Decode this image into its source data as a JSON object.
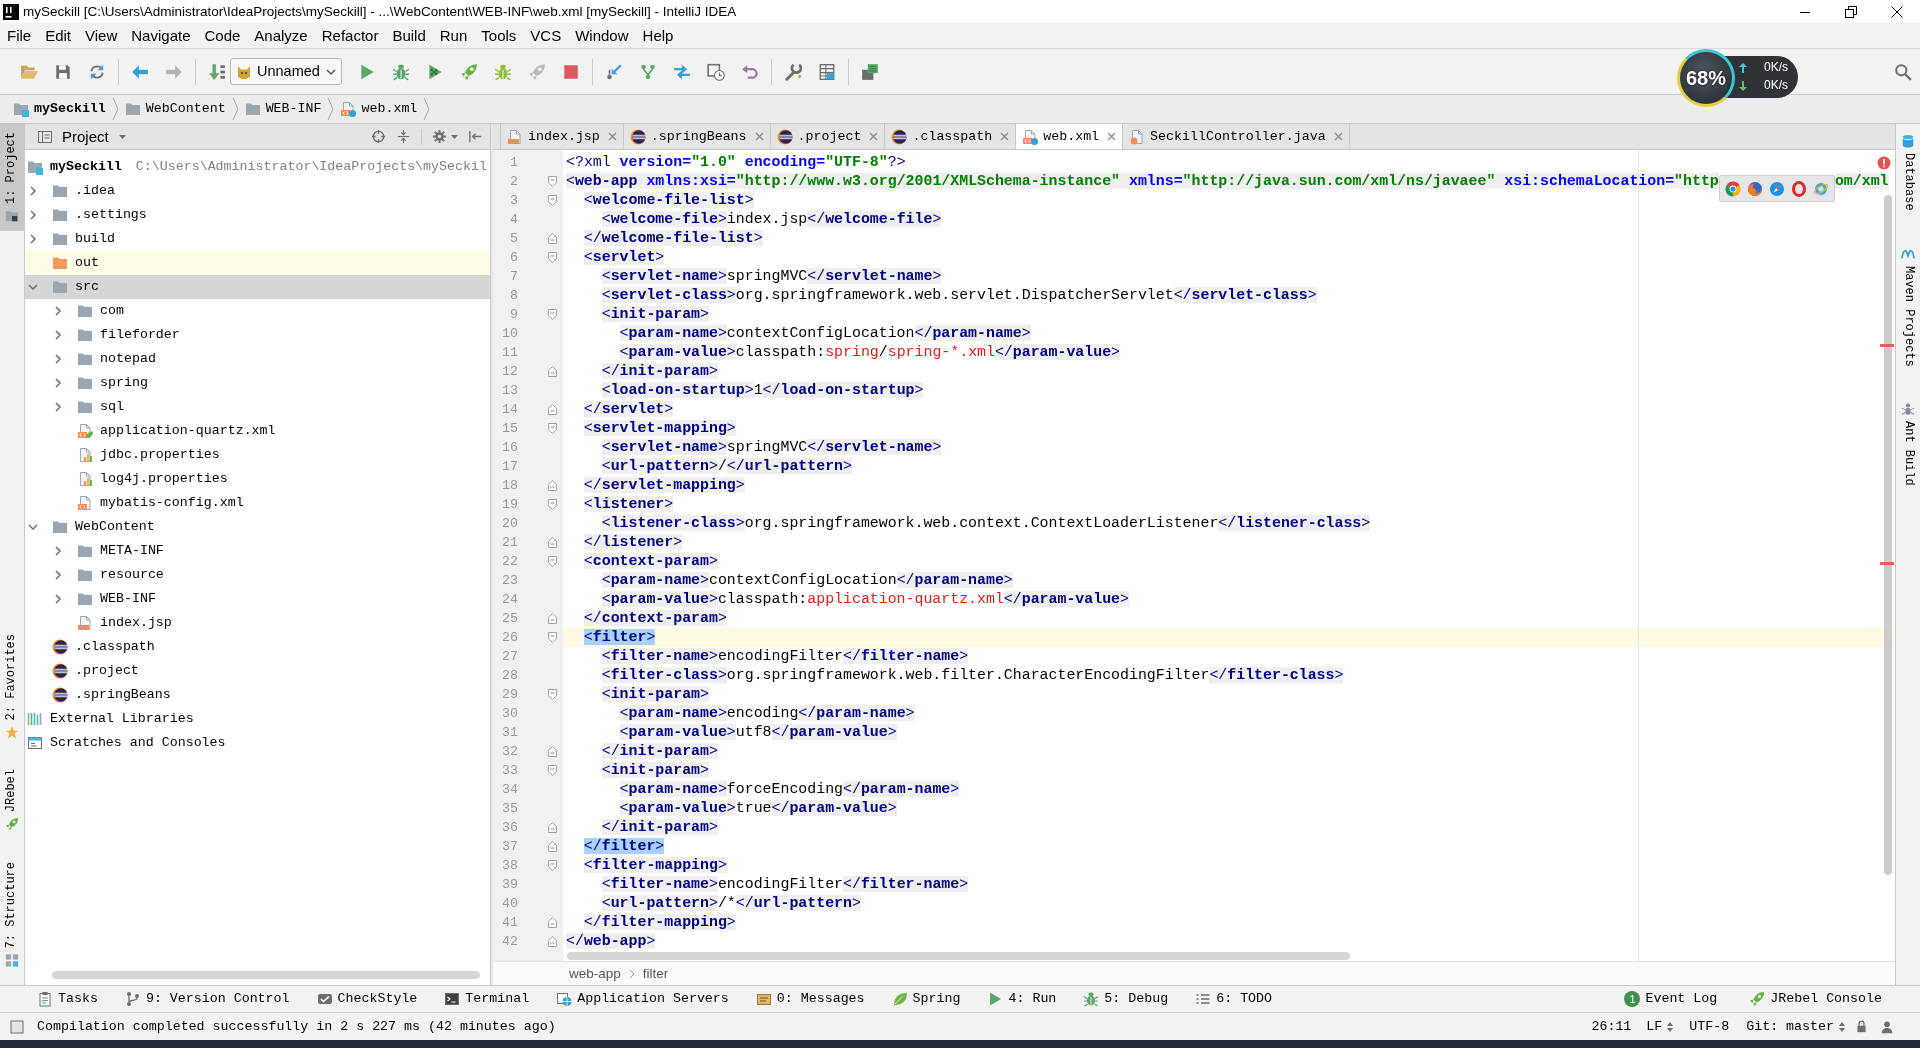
{
  "window": {
    "title": "mySeckill [C:\\Users\\Administrator\\IdeaProjects\\mySeckill] - ...\\WebContent\\WEB-INF\\web.xml [mySeckill] - IntelliJ IDEA"
  },
  "menu": [
    "File",
    "Edit",
    "View",
    "Navigate",
    "Code",
    "Analyze",
    "Refactor",
    "Build",
    "Run",
    "Tools",
    "VCS",
    "Window",
    "Help"
  ],
  "toolbar": {
    "run_configuration": "Unnamed"
  },
  "network_monitor": {
    "percent": "68%",
    "upload": "0K/s",
    "download": "0K/s"
  },
  "navigation_bar": [
    {
      "label": "mySeckill",
      "kind": "module"
    },
    {
      "label": "WebContent",
      "kind": "folder"
    },
    {
      "label": "WEB-INF",
      "kind": "folder"
    },
    {
      "label": "web.xml",
      "kind": "web_xml"
    }
  ],
  "left_tool_strip": {
    "top": [
      {
        "label": "1: Project",
        "kind": "project",
        "selected": true
      }
    ],
    "bottom": [
      {
        "label": "2: Favorites",
        "kind": "favorites",
        "selected": false
      },
      {
        "label": "JRebel",
        "kind": "jrebel",
        "selected": false
      },
      {
        "label": "7: Structure",
        "kind": "structure",
        "selected": false
      }
    ]
  },
  "project_panel": {
    "title": "Project",
    "tree": [
      {
        "label": "mySeckill",
        "path": "C:\\Users\\Administrator\\IdeaProjects\\mySeckil",
        "kind": "module",
        "selected": false,
        "highlighted": false,
        "children": [
          {
            "label": ".idea",
            "kind": "folder",
            "expanded": false,
            "selected": false,
            "highlighted": false
          },
          {
            "label": ".settings",
            "kind": "folder",
            "expanded": false,
            "selected": false,
            "highlighted": false
          },
          {
            "label": "build",
            "kind": "folder",
            "expanded": false,
            "selected": false,
            "highlighted": false
          },
          {
            "label": "out",
            "kind": "excluded_folder",
            "selected": false,
            "highlighted": true
          },
          {
            "label": "src",
            "kind": "folder",
            "expanded": true,
            "selected": true,
            "highlighted": false,
            "children": [
              {
                "label": "com",
                "kind": "folder",
                "expanded": false,
                "selected": false,
                "highlighted": false
              },
              {
                "label": "fileforder",
                "kind": "folder",
                "expanded": false,
                "selected": false,
                "highlighted": false
              },
              {
                "label": "notepad",
                "kind": "folder",
                "expanded": false,
                "selected": false,
                "highlighted": false
              },
              {
                "label": "spring",
                "kind": "folder",
                "expanded": false,
                "selected": false,
                "highlighted": false
              },
              {
                "label": "sql",
                "kind": "folder",
                "expanded": false,
                "selected": false,
                "highlighted": false
              },
              {
                "label": "application-quartz.xml",
                "kind": "spring_xml",
                "selected": false,
                "highlighted": false
              },
              {
                "label": "jdbc.properties",
                "kind": "properties",
                "selected": false,
                "highlighted": false
              },
              {
                "label": "log4j.properties",
                "kind": "properties",
                "selected": false,
                "highlighted": false
              },
              {
                "label": "mybatis-config.xml",
                "kind": "xml",
                "selected": false,
                "highlighted": false
              }
            ]
          },
          {
            "label": "WebContent",
            "kind": "folder",
            "expanded": true,
            "selected": false,
            "highlighted": false,
            "children": [
              {
                "label": "META-INF",
                "kind": "folder",
                "expanded": false,
                "selected": false,
                "highlighted": false
              },
              {
                "label": "resource",
                "kind": "folder",
                "expanded": false,
                "selected": false,
                "highlighted": false
              },
              {
                "label": "WEB-INF",
                "kind": "folder",
                "expanded": false,
                "selected": false,
                "highlighted": false
              },
              {
                "label": "index.jsp",
                "kind": "jsp",
                "selected": false,
                "highlighted": false
              }
            ]
          },
          {
            "label": ".classpath",
            "kind": "eclipse",
            "selected": false,
            "highlighted": false
          },
          {
            "label": ".project",
            "kind": "eclipse",
            "selected": false,
            "highlighted": false
          },
          {
            "label": ".springBeans",
            "kind": "eclipse",
            "selected": false,
            "highlighted": false
          }
        ]
      },
      {
        "label": "External Libraries",
        "kind": "libraries",
        "selected": false,
        "highlighted": false
      },
      {
        "label": "Scratches and Consoles",
        "kind": "scratches",
        "selected": false,
        "highlighted": false
      }
    ]
  },
  "editor": {
    "tabs": [
      {
        "label": "index.jsp",
        "kind": "jsp",
        "selected": false
      },
      {
        "label": ".springBeans",
        "kind": "eclipse",
        "selected": false
      },
      {
        "label": ".project",
        "kind": "eclipse",
        "selected": false
      },
      {
        "label": ".classpath",
        "kind": "eclipse",
        "selected": false
      },
      {
        "label": "web.xml",
        "kind": "web_xml",
        "selected": true
      },
      {
        "label": "SeckillController.java",
        "kind": "java",
        "selected": false
      }
    ],
    "lines": [
      {
        "n": "1",
        "current": false,
        "parts": [
          {
            "kind": "pi",
            "o": "<?",
            "t": "xml",
            "attrs": [
              {
                "a": " version=",
                "v": "\"1.0\""
              },
              {
                "a": " encoding=",
                "v": "\"UTF-8\""
              }
            ],
            "c": "?>"
          }
        ]
      },
      {
        "n": "2",
        "kind": "fold_start",
        "current": false,
        "parts": [
          {
            "kind": "tag",
            "o": "<",
            "t": "web-app",
            "attrs": [
              {
                "a": " xmlns:xsi=",
                "v": "\"http://www.w3.org/2001/XMLSchema-instance\""
              },
              {
                "a": " xmlns=",
                "v": "\"http://java.sun.com/xml/ns/javaee\""
              },
              {
                "a": " xsi:schemaLocation=",
                "v": "\"http"
              }
            ]
          },
          {
            "kind": "covered_tail",
            "s": "om/xml"
          }
        ],
        "children": [
          {
            "n": "3",
            "kind": "fold_start",
            "current": false,
            "parts": [
              {
                "kind": "tag",
                "o": "<",
                "t": "welcome-file-list",
                "c": ">"
              }
            ],
            "children": [
              {
                "n": "4",
                "current": false,
                "parts": [
                  {
                    "kind": "tag",
                    "o": "<",
                    "t": "welcome-file",
                    "c": ">"
                  },
                  {
                    "kind": "text",
                    "s": "index.jsp"
                  },
                  {
                    "kind": "tag",
                    "o": "</",
                    "t": "welcome-file",
                    "c": ">"
                  }
                ]
              }
            ]
          },
          {
            "n": "5",
            "kind": "fold_end",
            "current": false,
            "parts": [
              {
                "kind": "tag",
                "o": "</",
                "t": "welcome-file-list",
                "c": ">"
              }
            ]
          },
          {
            "n": "6",
            "kind": "fold_start",
            "current": false,
            "parts": [
              {
                "kind": "tag",
                "o": "<",
                "t": "servlet",
                "c": ">"
              }
            ],
            "children": [
              {
                "n": "7",
                "current": false,
                "parts": [
                  {
                    "kind": "tag",
                    "o": "<",
                    "t": "servlet-name",
                    "c": ">"
                  },
                  {
                    "kind": "text",
                    "s": "springMVC"
                  },
                  {
                    "kind": "tag",
                    "o": "</",
                    "t": "servlet-name",
                    "c": ">"
                  }
                ]
              },
              {
                "n": "8",
                "current": false,
                "parts": [
                  {
                    "kind": "tag",
                    "o": "<",
                    "t": "servlet-class",
                    "c": ">"
                  },
                  {
                    "kind": "text",
                    "s": "org.springframework.web.servlet.DispatcherServlet"
                  },
                  {
                    "kind": "tag",
                    "o": "</",
                    "t": "servlet-class",
                    "c": ">"
                  }
                ]
              },
              {
                "n": "9",
                "kind": "fold_start",
                "current": false,
                "parts": [
                  {
                    "kind": "tag",
                    "o": "<",
                    "t": "init-param",
                    "c": ">"
                  }
                ],
                "children": [
                  {
                    "n": "10",
                    "current": false,
                    "parts": [
                      {
                        "kind": "tag",
                        "o": "<",
                        "t": "param-name",
                        "c": ">"
                      },
                      {
                        "kind": "text",
                        "s": "contextConfigLocation"
                      },
                      {
                        "kind": "tag",
                        "o": "</",
                        "t": "param-name",
                        "c": ">"
                      }
                    ]
                  },
                  {
                    "n": "11",
                    "current": false,
                    "parts": [
                      {
                        "kind": "tag",
                        "o": "<",
                        "t": "param-value",
                        "c": ">"
                      },
                      {
                        "kind": "text",
                        "s": "classpath:"
                      },
                      {
                        "kind": "ref",
                        "s": "spring"
                      },
                      {
                        "kind": "text",
                        "s": "/"
                      },
                      {
                        "kind": "ref",
                        "s": "spring-*.xml"
                      },
                      {
                        "kind": "tag",
                        "o": "</",
                        "t": "param-value",
                        "c": ">"
                      }
                    ]
                  }
                ]
              },
              {
                "n": "12",
                "kind": "fold_end",
                "current": false,
                "parts": [
                  {
                    "kind": "tag",
                    "o": "</",
                    "t": "init-param",
                    "c": ">"
                  }
                ]
              },
              {
                "n": "13",
                "current": false,
                "parts": [
                  {
                    "kind": "tag",
                    "o": "<",
                    "t": "load-on-startup",
                    "c": ">"
                  },
                  {
                    "kind": "text",
                    "s": "1"
                  },
                  {
                    "kind": "tag",
                    "o": "</",
                    "t": "load-on-startup",
                    "c": ">"
                  }
                ]
              }
            ]
          },
          {
            "n": "14",
            "kind": "fold_end",
            "current": false,
            "parts": [
              {
                "kind": "tag",
                "o": "</",
                "t": "servlet",
                "c": ">"
              }
            ]
          },
          {
            "n": "15",
            "kind": "fold_start",
            "current": false,
            "parts": [
              {
                "kind": "tag",
                "o": "<",
                "t": "servlet-mapping",
                "c": ">"
              }
            ],
            "children": [
              {
                "n": "16",
                "current": false,
                "parts": [
                  {
                    "kind": "tag",
                    "o": "<",
                    "t": "servlet-name",
                    "c": ">"
                  },
                  {
                    "kind": "text",
                    "s": "springMVC"
                  },
                  {
                    "kind": "tag",
                    "o": "</",
                    "t": "servlet-name",
                    "c": ">"
                  }
                ]
              },
              {
                "n": "17",
                "current": false,
                "parts": [
                  {
                    "kind": "tag",
                    "o": "<",
                    "t": "url-pattern",
                    "c": ">"
                  },
                  {
                    "kind": "text",
                    "s": "/"
                  },
                  {
                    "kind": "tag",
                    "o": "</",
                    "t": "url-pattern",
                    "c": ">"
                  }
                ]
              }
            ]
          },
          {
            "n": "18",
            "kind": "fold_end",
            "current": false,
            "parts": [
              {
                "kind": "tag",
                "o": "</",
                "t": "servlet-mapping",
                "c": ">"
              }
            ]
          },
          {
            "n": "19",
            "kind": "fold_start",
            "current": false,
            "parts": [
              {
                "kind": "tag",
                "o": "<",
                "t": "listener",
                "c": ">"
              }
            ],
            "children": [
              {
                "n": "20",
                "current": false,
                "parts": [
                  {
                    "kind": "tag",
                    "o": "<",
                    "t": "listener-class",
                    "c": ">"
                  },
                  {
                    "kind": "text",
                    "s": "org.springframework.web.context.ContextLoaderListener"
                  },
                  {
                    "kind": "tag",
                    "o": "</",
                    "t": "listener-class",
                    "c": ">"
                  }
                ]
              }
            ]
          },
          {
            "n": "21",
            "kind": "fold_end",
            "current": false,
            "parts": [
              {
                "kind": "tag",
                "o": "</",
                "t": "listener",
                "c": ">"
              }
            ]
          },
          {
            "n": "22",
            "kind": "fold_start",
            "current": false,
            "parts": [
              {
                "kind": "tag",
                "o": "<",
                "t": "context-param",
                "c": ">"
              }
            ],
            "children": [
              {
                "n": "23",
                "current": false,
                "parts": [
                  {
                    "kind": "tag",
                    "o": "<",
                    "t": "param-name",
                    "c": ">"
                  },
                  {
                    "kind": "text",
                    "s": "contextConfigLocation"
                  },
                  {
                    "kind": "tag",
                    "o": "</",
                    "t": "param-name",
                    "c": ">"
                  }
                ]
              },
              {
                "n": "24",
                "current": false,
                "parts": [
                  {
                    "kind": "tag",
                    "o": "<",
                    "t": "param-value",
                    "c": ">"
                  },
                  {
                    "kind": "text",
                    "s": "classpath:"
                  },
                  {
                    "kind": "ref",
                    "s": "application-quartz.xml"
                  },
                  {
                    "kind": "tag",
                    "o": "</",
                    "t": "param-value",
                    "c": ">"
                  }
                ]
              }
            ]
          },
          {
            "n": "25",
            "kind": "fold_end",
            "current": false,
            "parts": [
              {
                "kind": "tag",
                "o": "</",
                "t": "context-param",
                "c": ">"
              }
            ]
          },
          {
            "n": "26",
            "kind": "fold_start",
            "current": true,
            "parts": [
              {
                "kind": "tag",
                "o": "<",
                "t": "filter",
                "c": ">",
                "match": true
              }
            ],
            "children": [
              {
                "n": "27",
                "current": false,
                "parts": [
                  {
                    "kind": "tag",
                    "o": "<",
                    "t": "filter-name",
                    "c": ">"
                  },
                  {
                    "kind": "text",
                    "s": "encodingFilter"
                  },
                  {
                    "kind": "tag",
                    "o": "</",
                    "t": "filter-name",
                    "c": ">"
                  }
                ]
              },
              {
                "n": "28",
                "current": false,
                "parts": [
                  {
                    "kind": "tag",
                    "o": "<",
                    "t": "filter-class",
                    "c": ">"
                  },
                  {
                    "kind": "text",
                    "s": "org.springframework.web.filter.CharacterEncodingFilter"
                  },
                  {
                    "kind": "tag",
                    "o": "</",
                    "t": "filter-class",
                    "c": ">"
                  }
                ]
              },
              {
                "n": "29",
                "kind": "fold_start",
                "current": false,
                "parts": [
                  {
                    "kind": "tag",
                    "o": "<",
                    "t": "init-param",
                    "c": ">"
                  }
                ],
                "children": [
                  {
                    "n": "30",
                    "current": false,
                    "parts": [
                      {
                        "kind": "tag",
                        "o": "<",
                        "t": "param-name",
                        "c": ">"
                      },
                      {
                        "kind": "text",
                        "s": "encoding"
                      },
                      {
                        "kind": "tag",
                        "o": "</",
                        "t": "param-name",
                        "c": ">"
                      }
                    ]
                  },
                  {
                    "n": "31",
                    "current": false,
                    "parts": [
                      {
                        "kind": "tag",
                        "o": "<",
                        "t": "param-value",
                        "c": ">"
                      },
                      {
                        "kind": "text",
                        "s": "utf8"
                      },
                      {
                        "kind": "tag",
                        "o": "</",
                        "t": "param-value",
                        "c": ">"
                      }
                    ]
                  }
                ]
              },
              {
                "n": "32",
                "kind": "fold_end",
                "current": false,
                "parts": [
                  {
                    "kind": "tag",
                    "o": "</",
                    "t": "init-param",
                    "c": ">"
                  }
                ]
              },
              {
                "n": "33",
                "kind": "fold_start",
                "current": false,
                "parts": [
                  {
                    "kind": "tag",
                    "o": "<",
                    "t": "init-param",
                    "c": ">"
                  }
                ],
                "children": [
                  {
                    "n": "34",
                    "current": false,
                    "parts": [
                      {
                        "kind": "tag",
                        "o": "<",
                        "t": "param-name",
                        "c": ">"
                      },
                      {
                        "kind": "text",
                        "s": "forceEncoding"
                      },
                      {
                        "kind": "tag",
                        "o": "</",
                        "t": "param-name",
                        "c": ">"
                      }
                    ]
                  },
                  {
                    "n": "35",
                    "current": false,
                    "parts": [
                      {
                        "kind": "tag",
                        "o": "<",
                        "t": "param-value",
                        "c": ">"
                      },
                      {
                        "kind": "text",
                        "s": "true"
                      },
                      {
                        "kind": "tag",
                        "o": "</",
                        "t": "param-value",
                        "c": ">"
                      }
                    ]
                  }
                ]
              },
              {
                "n": "36",
                "kind": "fold_end",
                "current": false,
                "parts": [
                  {
                    "kind": "tag",
                    "o": "</",
                    "t": "init-param",
                    "c": ">"
                  }
                ]
              }
            ]
          },
          {
            "n": "37",
            "kind": "fold_end",
            "current": false,
            "parts": [
              {
                "kind": "tag",
                "o": "</",
                "t": "filter",
                "c": ">",
                "match": true
              }
            ]
          },
          {
            "n": "38",
            "kind": "fold_start",
            "current": false,
            "parts": [
              {
                "kind": "tag",
                "o": "<",
                "t": "filter-mapping",
                "c": ">"
              }
            ],
            "children": [
              {
                "n": "39",
                "current": false,
                "parts": [
                  {
                    "kind": "tag",
                    "o": "<",
                    "t": "filter-name",
                    "c": ">"
                  },
                  {
                    "kind": "text",
                    "s": "encodingFilter"
                  },
                  {
                    "kind": "tag",
                    "o": "</",
                    "t": "filter-name",
                    "c": ">"
                  }
                ]
              },
              {
                "n": "40",
                "current": false,
                "parts": [
                  {
                    "kind": "tag",
                    "o": "<",
                    "t": "url-pattern",
                    "c": ">"
                  },
                  {
                    "kind": "text",
                    "s": "/*"
                  },
                  {
                    "kind": "tag",
                    "o": "</",
                    "t": "url-pattern",
                    "c": ">"
                  }
                ]
              }
            ]
          },
          {
            "n": "41",
            "kind": "fold_end",
            "current": false,
            "parts": [
              {
                "kind": "tag",
                "o": "</",
                "t": "filter-mapping",
                "c": ">"
              }
            ]
          }
        ]
      },
      {
        "n": "42",
        "kind": "fold_end",
        "current": false,
        "parts": [
          {
            "kind": "tag",
            "o": "</",
            "t": "web-app",
            "c": ">"
          }
        ]
      }
    ],
    "breadcrumb": [
      "web-app",
      "filter"
    ]
  },
  "right_tool_strip": [
    {
      "label": "Database",
      "kind": "database"
    },
    {
      "label": "Maven Projects",
      "kind": "maven"
    },
    {
      "label": "Ant Build",
      "kind": "ant"
    }
  ],
  "bottom_tool_bar": {
    "left": [
      {
        "label": "Tasks",
        "kind": "tasks"
      },
      {
        "label": "9: Version Control",
        "kind": "vcs"
      },
      {
        "label": "CheckStyle",
        "kind": "checkstyle"
      },
      {
        "label": "Terminal",
        "kind": "terminal"
      },
      {
        "label": "Application Servers",
        "kind": "servers"
      },
      {
        "label": "0: Messages",
        "kind": "messages"
      },
      {
        "label": "Spring",
        "kind": "spring"
      },
      {
        "label": "4: Run",
        "kind": "run"
      },
      {
        "label": "5: Debug",
        "kind": "debug"
      },
      {
        "label": "6: TODO",
        "kind": "todo"
      }
    ],
    "right": [
      {
        "label": "Event Log",
        "kind": "event_log",
        "badge": "1"
      },
      {
        "label": "JRebel Console",
        "kind": "jrebel"
      }
    ]
  },
  "status_bar": {
    "message": "Compilation completed successfully in 2 s 227 ms (42 minutes ago)",
    "caret": "26:11",
    "line_separator": "LF",
    "encoding": "UTF-8",
    "vcs_branch": "Git: master"
  }
}
